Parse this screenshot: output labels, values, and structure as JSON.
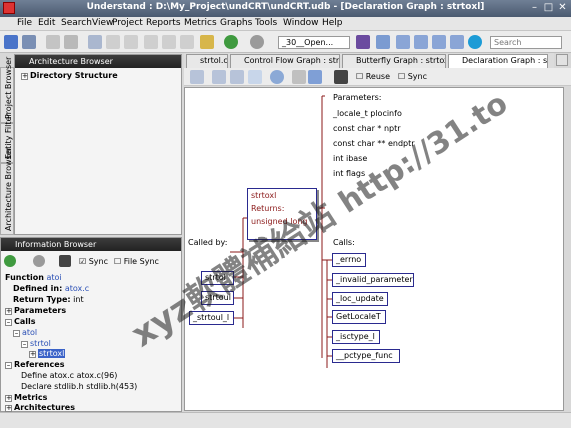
{
  "window": {
    "title": "Understand : D:\\My_Project\\undCRT\\undCRT.udb - [Declaration Graph : strtoxl]"
  },
  "menu": [
    "File",
    "Edit",
    "Search",
    "View",
    "Project",
    "Reports",
    "Metrics",
    "Graphs",
    "Tools",
    "Window",
    "Help"
  ],
  "toolbar": {
    "combo_value": "_30__Open...",
    "search_value": "Search"
  },
  "architecture_browser": {
    "title": "Architecture Browser",
    "root": "Directory Structure"
  },
  "side_tabs": [
    "Project Browser",
    "Entity Filter",
    "Architecture Browser"
  ],
  "info_browser": {
    "title": "Information Browser",
    "sync_label": "Sync",
    "file_sync_label": "File Sync",
    "function_label": "Function",
    "function_name": "atoi",
    "defined_in_label": "Defined in:",
    "defined_in_value": "atox.c",
    "return_type_label": "Return Type:",
    "return_type_value": "int",
    "parameters_label": "Parameters",
    "calls_label": "Calls",
    "call_tree": [
      "atol",
      "strtol",
      "strtoxl"
    ],
    "references_label": "References",
    "references": [
      "Define  atox.c  atox.c(96)",
      "Declare  stdlib.h  stdlib.h(453)"
    ],
    "metrics_label": "Metrics",
    "architectures_label": "Architectures"
  },
  "tabs": [
    "strtol.c",
    "Control Flow Graph : strtoxl",
    "Butterfly Graph : strtoxl",
    "Declaration Graph : strtoxl"
  ],
  "graph_toolbar": {
    "reuse_label": "Reuse",
    "sync_label": "Sync"
  },
  "graph": {
    "parameters_title": "Parameters:",
    "parameters": [
      "_locale_t plocinfo",
      "const char * nptr",
      "const char ** endptr",
      "int ibase",
      "int flags"
    ],
    "center": {
      "name": "strtoxl",
      "returns": "Returns:",
      "return_type": "unsigned long"
    },
    "called_by_title": "Called by:",
    "called_by": [
      "strtol",
      "strtoul",
      "_strtoul_l"
    ],
    "calls_title": "Calls:",
    "calls": [
      "_errno",
      "_invalid_parameter",
      "_loc_update",
      "GetLocaleT",
      "_isctype_l",
      "__pctype_func"
    ]
  },
  "watermark": {
    "cjk": "xyz軟體補給站",
    "url": "http://31.to"
  },
  "colors": {
    "titlebar": "#4b5a70",
    "node_border": "#2a2a8f",
    "link": "#2a4fb5",
    "edge": "#8b1a1a"
  },
  "icons": [
    "new-file-icon",
    "open-icon",
    "save-icon",
    "undo-icon",
    "redo-icon",
    "cut-icon",
    "copy-icon",
    "paste-icon",
    "back-icon",
    "forward-icon",
    "refresh-icon",
    "search-icon",
    "zoom-icon",
    "hand-icon",
    "pointer-icon",
    "binoculars-icon"
  ]
}
